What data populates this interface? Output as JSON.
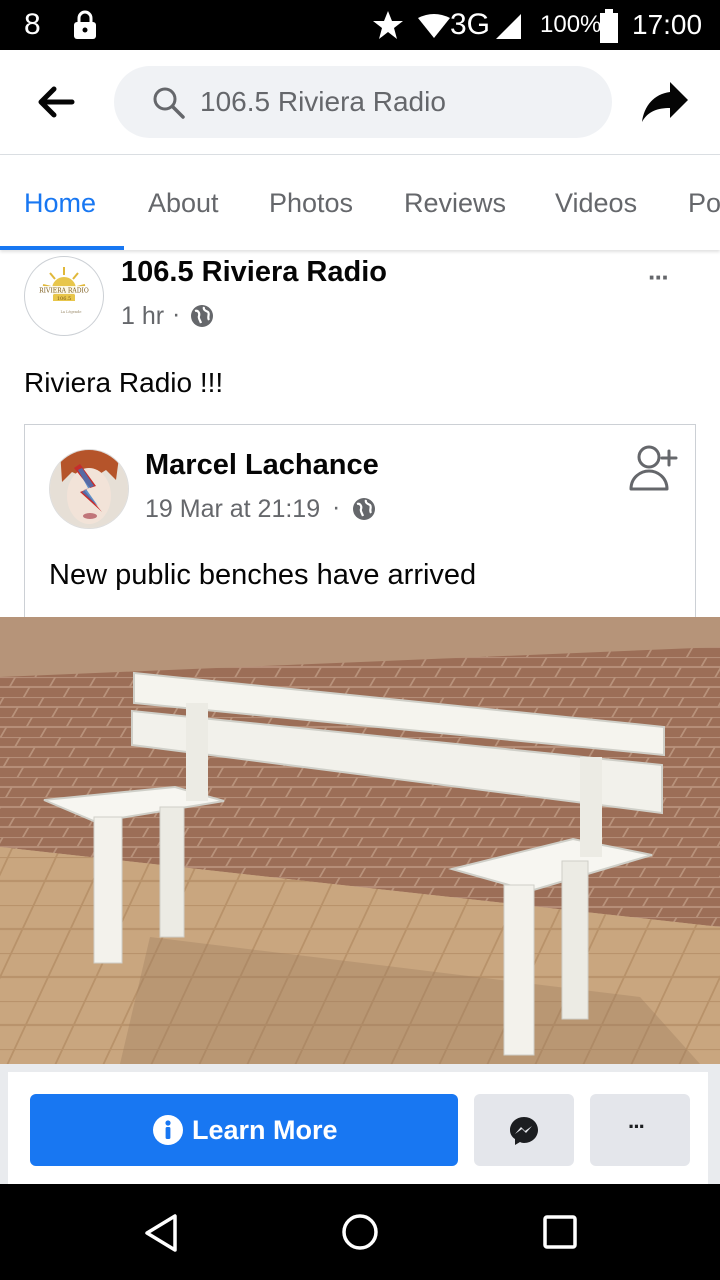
{
  "status_bar": {
    "notification_count": "8",
    "network": "3G",
    "battery": "100%",
    "time": "17:00"
  },
  "search": {
    "query": "106.5 Riviera Radio"
  },
  "tabs": [
    {
      "label": "Home",
      "active": true
    },
    {
      "label": "About"
    },
    {
      "label": "Photos"
    },
    {
      "label": "Reviews"
    },
    {
      "label": "Videos"
    },
    {
      "label": "Po"
    }
  ],
  "post": {
    "page_name": "106.5 Riviera Radio",
    "time": "1 hr",
    "separator": "·",
    "text": "Riviera Radio !!!",
    "logo_text": {
      "line1": "RIVIERA RADIO",
      "line2": "106.5",
      "line3": "La Légende"
    }
  },
  "shared_post": {
    "author": "Marcel Lachance",
    "time": "19 Mar at 21:19",
    "separator": "·",
    "text": "New public benches have arrived"
  },
  "actions": {
    "learn_more": "Learn More",
    "more": "···"
  },
  "colors": {
    "accent": "#1877f2",
    "secondary_text": "#65676b",
    "button_gray": "#e4e6eb"
  }
}
